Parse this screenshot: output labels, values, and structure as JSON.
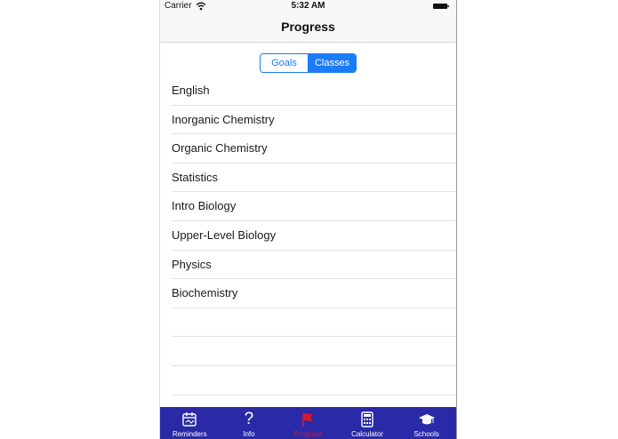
{
  "status_bar": {
    "carrier": "Carrier",
    "time": "5:32 AM"
  },
  "nav": {
    "title": "Progress"
  },
  "segmented": {
    "options": [
      "Goals",
      "Classes"
    ],
    "selected": "Classes",
    "accent_color": "#1a7cf6"
  },
  "classes": [
    "English",
    "Inorganic Chemistry",
    "Organic Chemistry",
    "Statistics",
    "Intro Biology",
    "Upper-Level Biology",
    "Physics",
    "Biochemistry"
  ],
  "tab_bar": {
    "background_color": "#2a2aa8",
    "active_color": "#d31a2e",
    "tabs": [
      {
        "label": "Reminders",
        "icon": "calendar-icon",
        "active": false
      },
      {
        "label": "Info",
        "icon": "question-mark-icon",
        "active": false
      },
      {
        "label": "Progress",
        "icon": "flag-icon",
        "active": true
      },
      {
        "label": "Calculator",
        "icon": "calculator-icon",
        "active": false
      },
      {
        "label": "Schools",
        "icon": "graduation-cap-icon",
        "active": false
      }
    ]
  }
}
